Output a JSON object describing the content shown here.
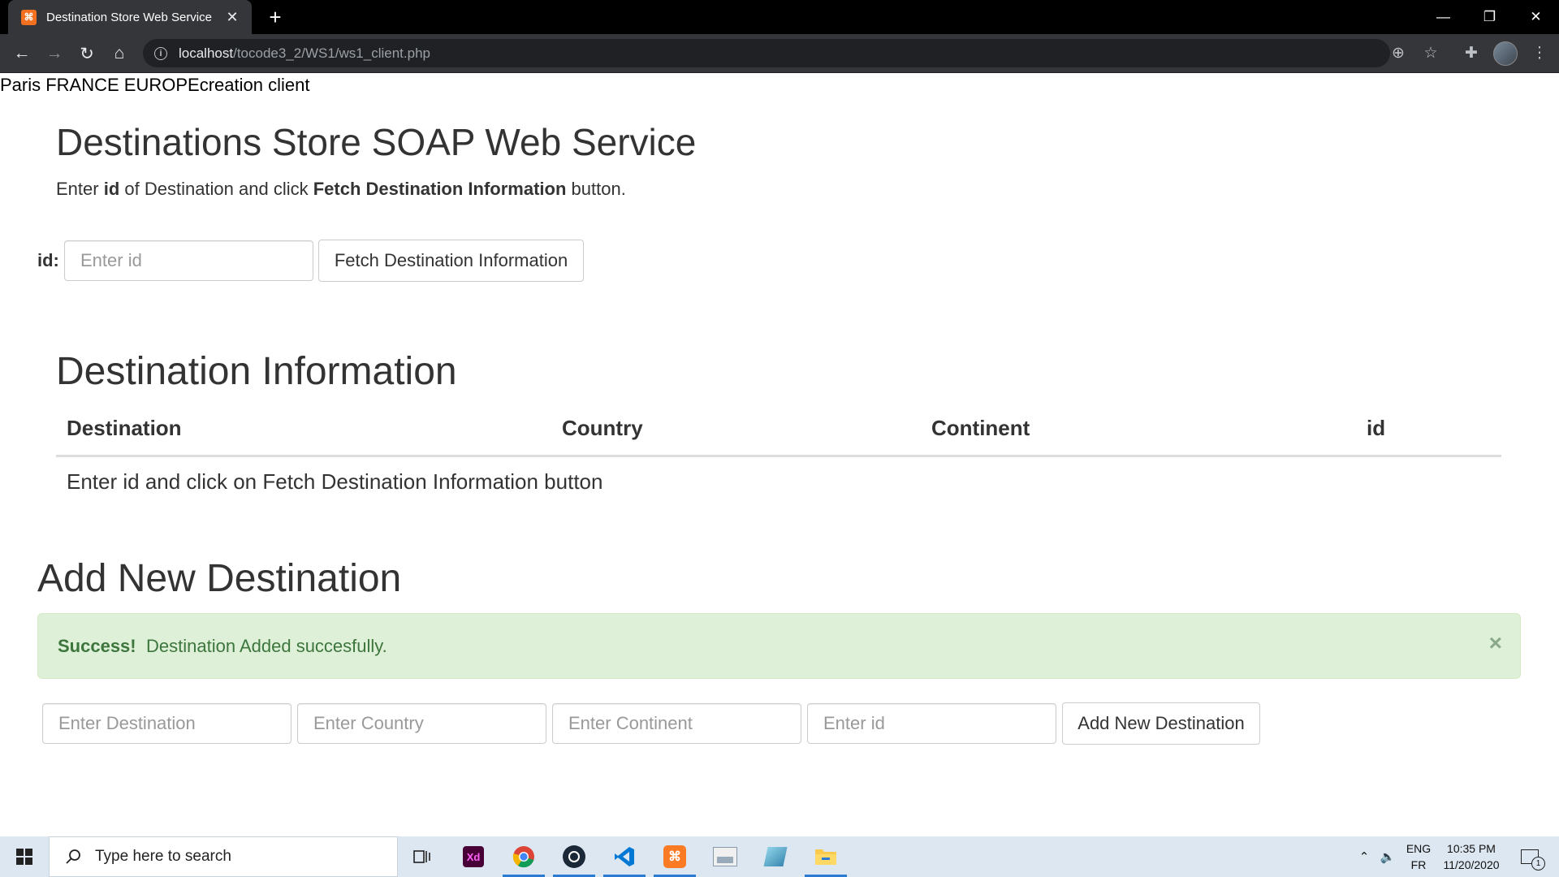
{
  "browser": {
    "tab_title": "Destination Store Web Service",
    "tab_favicon": "XAMPP",
    "url_host": "localhost",
    "url_path": "/tocode3_2/WS1/ws1_client.php"
  },
  "page": {
    "echo_text": "Paris FRANCE EUROPEcreation client",
    "heading": "Destinations Store SOAP Web Service",
    "lead": {
      "part1": "Enter ",
      "bold1": "id",
      "part2": " of Destination and click ",
      "bold2": "Fetch Destination Information",
      "part3": " button."
    },
    "fetch_form": {
      "id_label": "id:",
      "id_placeholder": "Enter id",
      "id_value": "",
      "button_label": "Fetch Destination Information"
    },
    "info_section": {
      "heading": "Destination Information",
      "columns": [
        "Destination",
        "Country",
        "Continent",
        "id"
      ],
      "empty_message": "Enter id and click on Fetch Destination Information button"
    },
    "add_section": {
      "heading": "Add New Destination",
      "alert": {
        "strong": "Success!",
        "message": "Destination Added succesfully.",
        "close": "×"
      },
      "inputs": [
        {
          "placeholder": "Enter Destination",
          "value": ""
        },
        {
          "placeholder": "Enter Country",
          "value": ""
        },
        {
          "placeholder": "Enter Continent",
          "value": ""
        },
        {
          "placeholder": "Enter id",
          "value": ""
        }
      ],
      "button_label": "Add New Destination"
    }
  },
  "taskbar": {
    "search_placeholder": "Type here to search",
    "apps": [
      "task-view",
      "adobe-xd",
      "chrome",
      "steam",
      "vscode",
      "xampp",
      "photo-viewer",
      "app",
      "file-explorer"
    ],
    "tray": {
      "lang_top": "ENG",
      "lang_bottom": "FR",
      "time": "10:35 PM",
      "date": "11/20/2020",
      "notification_count": "1"
    }
  },
  "colors": {
    "alert_bg": "#dff0d8",
    "alert_text": "#3c763d",
    "chrome_dark": "#35363a",
    "taskbar_bg": "#dde7f1"
  }
}
